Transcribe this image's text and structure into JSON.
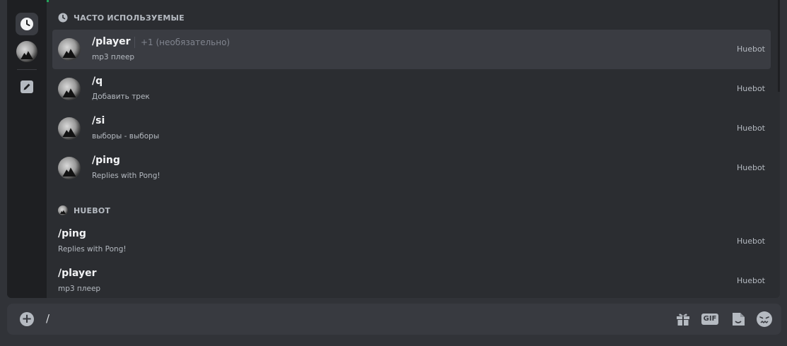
{
  "sections": {
    "frequent": {
      "title": "ЧАСТО ИСПОЛЬЗУЕМЫЕ",
      "icon": "clock-icon"
    },
    "app": {
      "title": "HUEBOT",
      "icon": "bot-avatar"
    }
  },
  "frequent_commands": [
    {
      "name": "/player",
      "option": "+1 (необязательно)",
      "description": "mp3 плеер",
      "app": "Huebot",
      "selected": true
    },
    {
      "name": "/q",
      "option": "",
      "description": "Добавить трек",
      "app": "Huebot",
      "selected": false
    },
    {
      "name": "/si",
      "option": "",
      "description": "выборы - выборы",
      "app": "Huebot",
      "selected": false
    },
    {
      "name": "/ping",
      "option": "",
      "description": "Replies with Pong!",
      "app": "Huebot",
      "selected": false
    }
  ],
  "app_commands": [
    {
      "name": "/ping",
      "description": "Replies with Pong!",
      "app": "Huebot"
    },
    {
      "name": "/player",
      "description": "mp3 плеер",
      "app": "Huebot"
    }
  ],
  "rail": {
    "items": [
      "clock-icon",
      "bot-avatar",
      "pencil-icon"
    ]
  },
  "input": {
    "value": "/"
  },
  "toolbar": {
    "gif_label": "GIF",
    "icons": [
      "gift-icon",
      "gif-icon",
      "sticker-icon",
      "emoji-icon"
    ]
  },
  "colors": {
    "accent_green": "#23a55a",
    "background": "#313338",
    "popup": "#2b2d31"
  }
}
